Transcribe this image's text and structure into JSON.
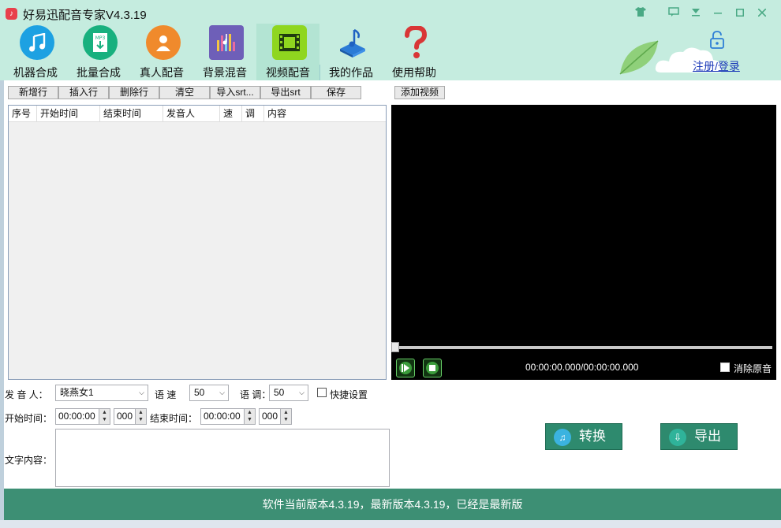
{
  "window": {
    "title": "好易迅配音专家V4.3.19",
    "controls": [
      "shirt-icon",
      "message-icon",
      "dropdown-icon",
      "minimize-icon",
      "maximize-icon",
      "close-icon"
    ]
  },
  "nav": {
    "items": [
      {
        "label": "机器合成",
        "icon": "music-note-icon",
        "color": "#1da1e2"
      },
      {
        "label": "批量合成",
        "icon": "mp3-download-icon",
        "color": "#18b07e"
      },
      {
        "label": "真人配音",
        "icon": "person-icon",
        "color": "#f08a2c"
      },
      {
        "label": "背景混音",
        "icon": "equalizer-icon",
        "color": "#7a5cc4"
      },
      {
        "label": "视频配音",
        "icon": "film-icon",
        "color": "#8fd61f"
      },
      {
        "label": "我的作品",
        "icon": "music-stand-icon",
        "color": "#2b7bd6"
      },
      {
        "label": "使用帮助",
        "icon": "question-icon",
        "color": "#d93636"
      }
    ],
    "active_index": 4
  },
  "login": {
    "label": "注册/登录"
  },
  "toolbar": {
    "buttons": [
      "新增行",
      "插入行",
      "删除行",
      "清空",
      "导入srt...",
      "导出srt",
      "保存"
    ],
    "add_video": "添加视频"
  },
  "grid": {
    "columns": [
      "序号",
      "开始时间",
      "结束时间",
      "发音人",
      "速",
      "调",
      "内容"
    ]
  },
  "video": {
    "time": "00:00:00.000/00:00:00.000",
    "mute_label": "消除原音",
    "progress": 0
  },
  "form": {
    "speaker_label": "发 音 人：",
    "speaker_value": "晓燕女1",
    "speed_label": "语 速",
    "speed_value": "50",
    "pitch_label": "语 调：",
    "pitch_value": "50",
    "quick_label": "快捷设置",
    "start_label": "开始时间：",
    "start_time": "00:00:00",
    "start_ms": "000",
    "end_label": "结束时间：",
    "end_time": "00:00:00",
    "end_ms": "000",
    "text_label": "文字内容："
  },
  "actions": {
    "convert": "转换",
    "export": "导出"
  },
  "status": {
    "text": "软件当前版本4.3.19，最新版本4.3.19，已经是最新版"
  },
  "colors": {
    "header_bg": "#c5ecdf",
    "status_bg": "#3d8f74",
    "button_green": "#2e8a6e",
    "link_blue": "#1b39b8"
  }
}
